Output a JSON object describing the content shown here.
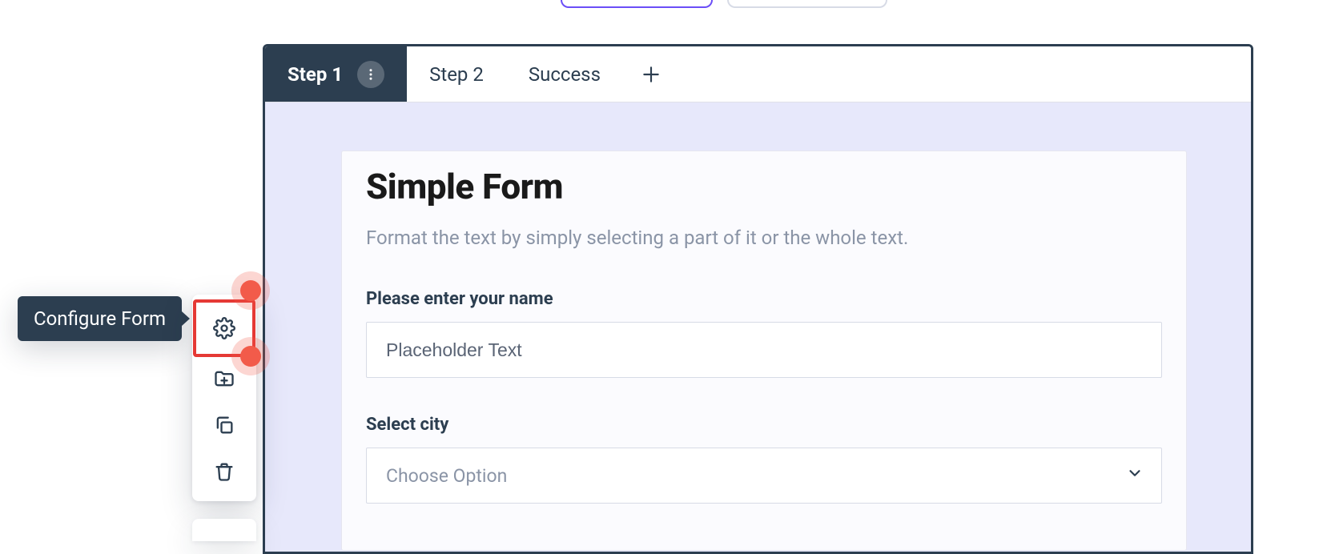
{
  "tabs": {
    "items": [
      {
        "label": "Step 1",
        "active": true
      },
      {
        "label": "Step 2",
        "active": false
      },
      {
        "label": "Success",
        "active": false
      }
    ]
  },
  "form": {
    "title": "Simple Form",
    "subtitle": "Format the text by simply selecting a part of it or the whole text.",
    "name_field": {
      "label": "Please enter your name",
      "placeholder": "Placeholder Text"
    },
    "city_field": {
      "label": "Select city",
      "placeholder": "Choose Option"
    }
  },
  "toolbar": {
    "tooltip": "Configure Form",
    "items": [
      {
        "name": "configure-form",
        "icon": "gear",
        "highlighted": true
      },
      {
        "name": "add-page",
        "icon": "folder-plus"
      },
      {
        "name": "duplicate",
        "icon": "copy"
      },
      {
        "name": "delete",
        "icon": "trash"
      }
    ]
  }
}
